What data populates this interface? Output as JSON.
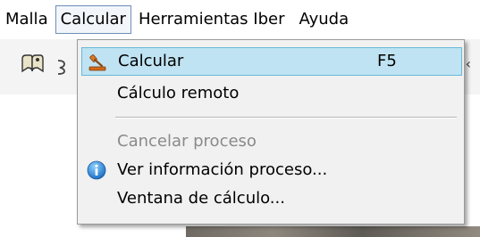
{
  "menubar": {
    "items": [
      {
        "label": "Malla"
      },
      {
        "label": "Calcular"
      },
      {
        "label": "Herramientas Iber"
      },
      {
        "label": "Ayuda"
      }
    ]
  },
  "toolbar": {
    "icons": [
      "help-tool-icon"
    ],
    "right_mark": "‹"
  },
  "dropdown": {
    "items": [
      {
        "label": "Calcular",
        "shortcut": "F5",
        "icon": "run-calculation-icon",
        "enabled": true,
        "highlighted": true
      },
      {
        "label": "Cálculo remoto",
        "enabled": true
      },
      {
        "label": "Cancelar proceso",
        "enabled": false
      },
      {
        "label": "Ver información proceso...",
        "icon": "info-icon",
        "enabled": true
      },
      {
        "label": "Ventana de cálculo...",
        "enabled": true
      }
    ]
  },
  "colors": {
    "highlight_bg": "#bfe3f2",
    "highlight_border": "#67b8d8",
    "disabled_text": "#8a8a8a",
    "menu_bg": "#f1f1f1"
  }
}
